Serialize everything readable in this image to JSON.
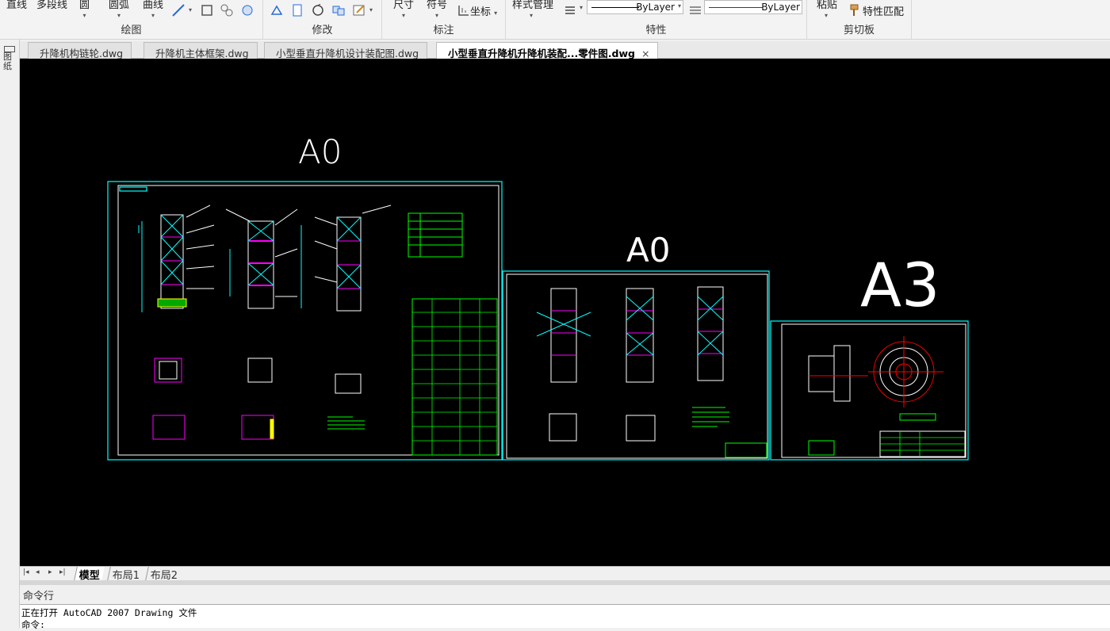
{
  "ribbon": {
    "draw_panel": {
      "title": "绘图",
      "tools": [
        "直线",
        "多段线",
        "圆",
        "圆弧",
        "曲线"
      ]
    },
    "modify_panel": {
      "title": "修改"
    },
    "annotate_panel": {
      "title": "标注",
      "tools": [
        "尺寸",
        "符号",
        "坐标"
      ]
    },
    "properties_panel": {
      "title": "特性",
      "style_manager": "样式管理",
      "linetype_value": "ByLayer",
      "color_value": "ByLayer",
      "linetype_color": "#000000",
      "line_color": "#cc0000"
    },
    "clipboard_panel": {
      "title": "剪切板",
      "paste": "粘贴",
      "match_properties": "特性匹配"
    }
  },
  "left_strip": {
    "label": "图纸"
  },
  "document_tabs": [
    {
      "label": "升降机构链轮.dwg",
      "active": false
    },
    {
      "label": "升降机主体框架.dwg",
      "active": false
    },
    {
      "label": "小型垂直升降机设计装配图.dwg",
      "active": false
    },
    {
      "label": "小型垂直升降机升降机装配...零件图.dwg",
      "active": true
    }
  ],
  "tab_close_icon": "×",
  "canvas": {
    "background": "#000000",
    "frame_color": "#00ffff",
    "sheets": [
      {
        "size_label": "A0"
      },
      {
        "size_label": "A0"
      },
      {
        "size_label": "A3"
      }
    ]
  },
  "layout_tabs": {
    "items": [
      {
        "label": "模型",
        "active": true
      },
      {
        "label": "布局1",
        "active": false
      },
      {
        "label": "布局2",
        "active": false
      }
    ]
  },
  "command_window": {
    "title": "命令行",
    "lines": [
      "正在打开 AutoCAD 2007 Drawing 文件",
      "命令:"
    ]
  }
}
